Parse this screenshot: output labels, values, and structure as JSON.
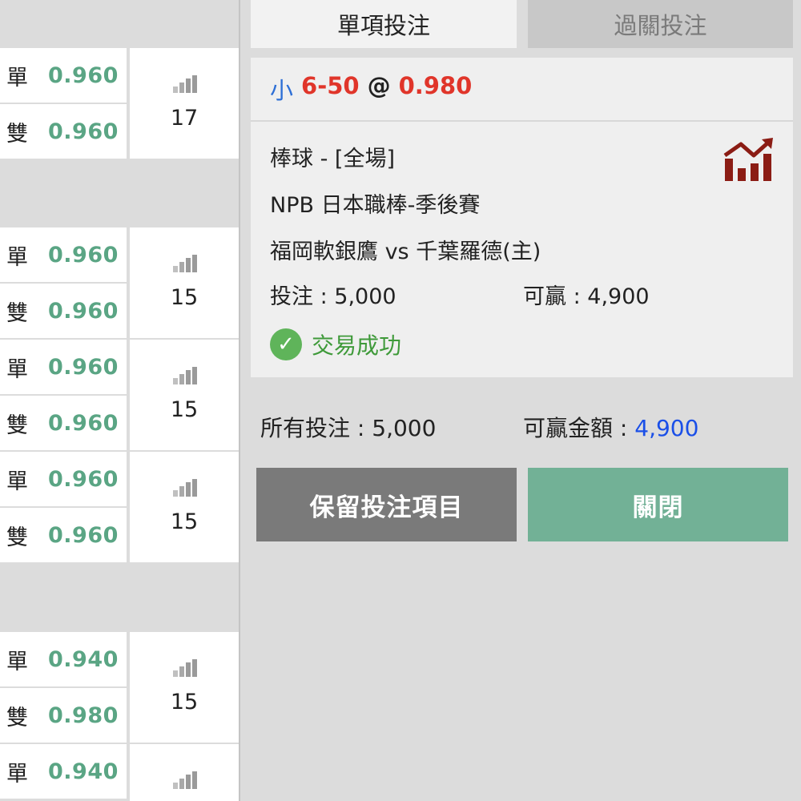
{
  "markets": [
    {
      "rows": [
        {
          "side": "單",
          "odds": "0.960"
        },
        {
          "side": "雙",
          "odds": "0.960"
        }
      ],
      "count": "17"
    },
    {
      "rows": [
        {
          "side": "單",
          "odds": "0.960"
        },
        {
          "side": "雙",
          "odds": "0.960"
        }
      ],
      "count": "15"
    },
    {
      "rows": [
        {
          "side": "單",
          "odds": "0.960"
        },
        {
          "side": "雙",
          "odds": "0.960"
        }
      ],
      "count": "15"
    },
    {
      "rows": [
        {
          "side": "單",
          "odds": "0.960"
        },
        {
          "side": "雙",
          "odds": "0.960"
        }
      ],
      "count": "15"
    },
    {
      "rows": [
        {
          "side": "單",
          "odds": "0.940"
        },
        {
          "side": "雙",
          "odds": "0.980"
        }
      ],
      "count": "15"
    },
    {
      "rows": [
        {
          "side": "單",
          "odds": "0.940"
        }
      ],
      "count": ""
    }
  ],
  "tabs": {
    "single": "單項投注",
    "parlay": "過關投注"
  },
  "selection": {
    "side": "小",
    "line": "6-50",
    "at": "@",
    "odds": "0.980"
  },
  "detail": {
    "sport": "棒球 - [全場]",
    "league": "NPB 日本職棒-季後賽",
    "match": "福岡軟銀鷹 vs 千葉羅德(主)",
    "stake_label": "投注 : ",
    "stake": "5,000",
    "win_label": "可贏 : ",
    "win": "4,900",
    "status": "交易成功"
  },
  "summary": {
    "total_label": "所有投注 : ",
    "total": "5,000",
    "win_label": "可贏金額 : ",
    "win": "4,900"
  },
  "buttons": {
    "keep": "保留投注項目",
    "close": "關閉"
  },
  "colors": {
    "odds_green": "#5aa584",
    "selection_red": "#e0352a",
    "selection_blue": "#2d6fd6",
    "win_blue": "#1a4fe8",
    "success_green": "#3f9a3a",
    "close_button": "#72b196",
    "keep_button": "#7a7a7a",
    "chart_icon": "#8b1c14"
  },
  "icons": {
    "trend": "trend-chart-icon",
    "signal": "signal-bars-icon",
    "success": "check-circle-icon"
  }
}
